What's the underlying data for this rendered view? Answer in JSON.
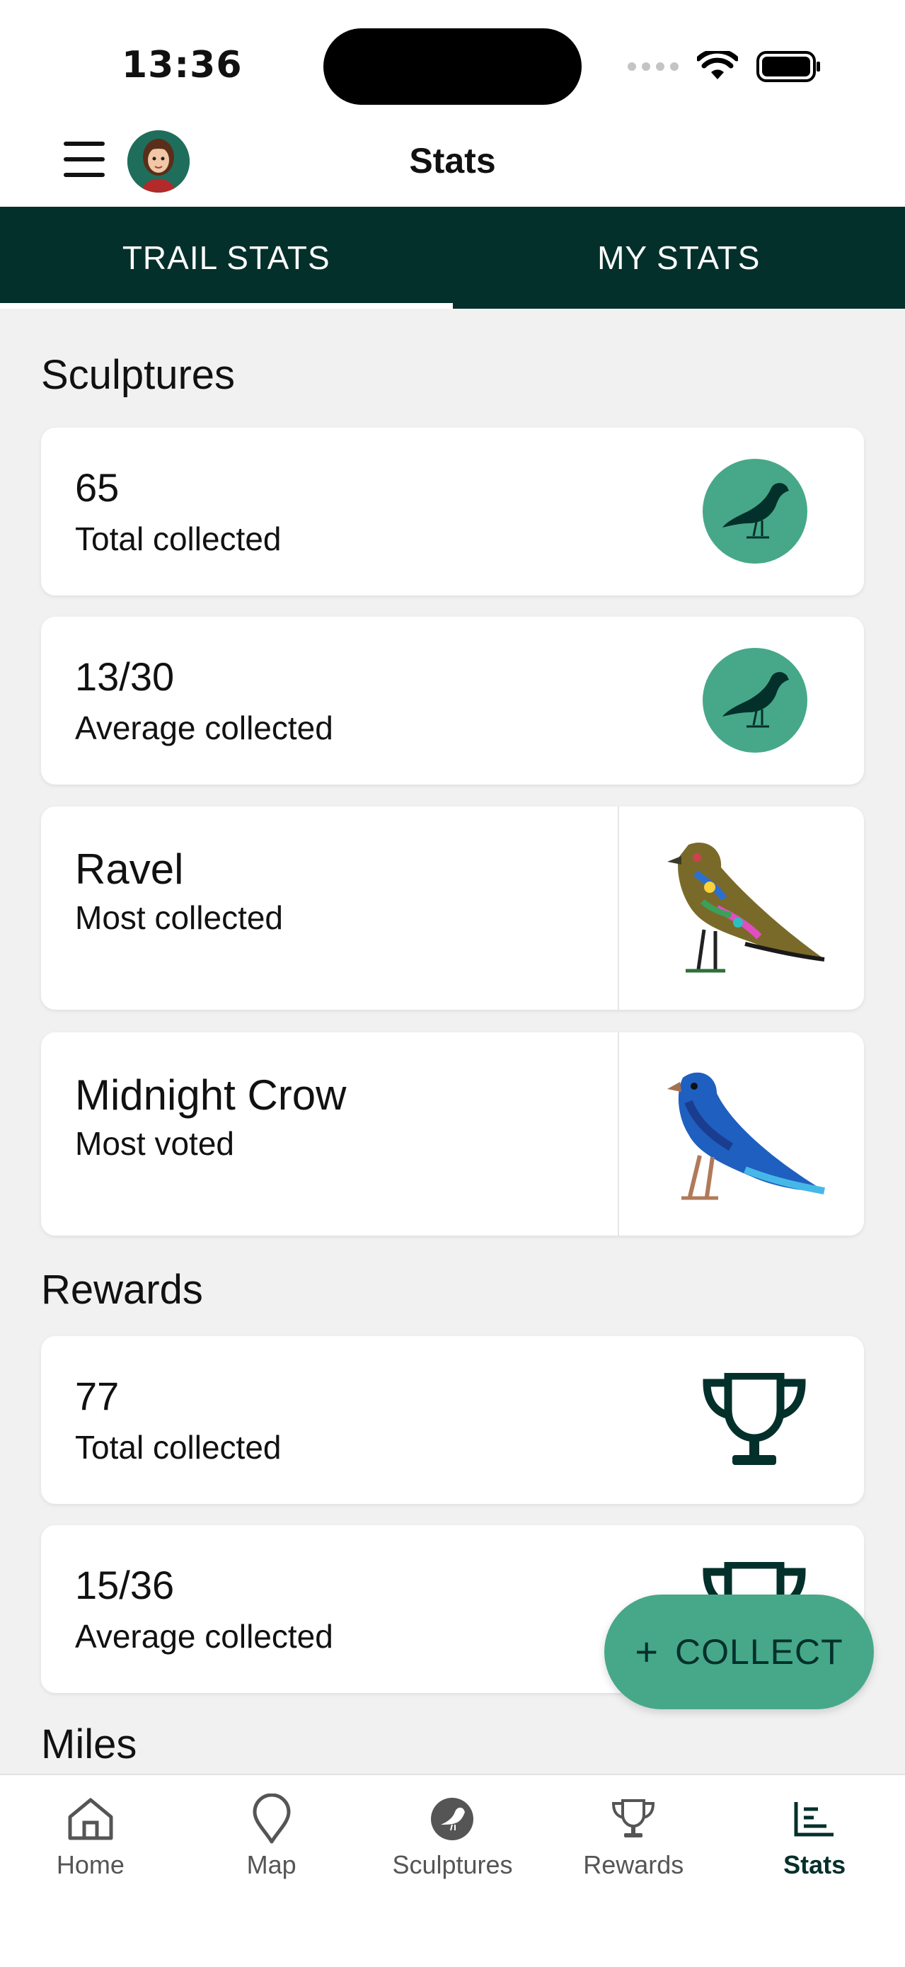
{
  "status_bar": {
    "time": "13:36"
  },
  "header": {
    "title": "Stats"
  },
  "tabs": [
    {
      "label": "TRAIL STATS",
      "active": true
    },
    {
      "label": "MY STATS",
      "active": false
    }
  ],
  "sections": {
    "sculptures_title": "Sculptures",
    "rewards_title": "Rewards",
    "miles_title": "Miles"
  },
  "sculpture_cards": [
    {
      "value": "65",
      "label": "Total collected",
      "icon": "bird-icon"
    },
    {
      "value": "13/30",
      "label": "Average collected",
      "icon": "bird-icon"
    },
    {
      "value": "Ravel",
      "label": "Most collected",
      "image": "ravel-bird-sculpture"
    },
    {
      "value": "Midnight Crow",
      "label": "Most voted",
      "image": "midnight-crow-sculpture"
    }
  ],
  "reward_cards": [
    {
      "value": "77",
      "label": "Total collected",
      "icon": "trophy-icon"
    },
    {
      "value": "15/36",
      "label": "Average collected",
      "icon": "trophy-icon"
    }
  ],
  "fab": {
    "label": "COLLECT",
    "icon": "plus-icon"
  },
  "bottom_nav": [
    {
      "label": "Home",
      "icon": "home-icon"
    },
    {
      "label": "Map",
      "icon": "map-pin-icon"
    },
    {
      "label": "Sculptures",
      "icon": "bird-icon"
    },
    {
      "label": "Rewards",
      "icon": "trophy-icon"
    },
    {
      "label": "Stats",
      "icon": "stats-icon",
      "active": true
    }
  ],
  "colors": {
    "brand_dark": "#04302b",
    "brand_green": "#46a889",
    "background": "#f1f1f1"
  }
}
